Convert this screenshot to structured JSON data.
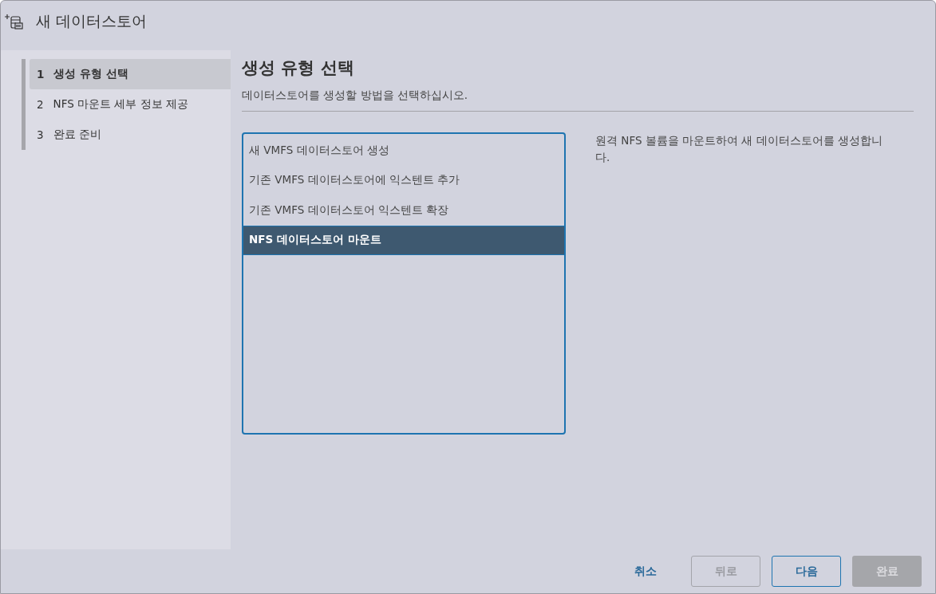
{
  "window": {
    "title": "새 데이터스토어"
  },
  "steps": [
    {
      "number": "1",
      "label": "생성 유형 선택",
      "selected": true
    },
    {
      "number": "2",
      "label": "NFS 마운트 세부 정보 제공",
      "selected": false
    },
    {
      "number": "3",
      "label": "완료 준비",
      "selected": false
    }
  ],
  "page": {
    "title": "생성 유형 선택",
    "subtitle": "데이터스토어를 생성할 방법을 선택하십시오."
  },
  "options": [
    {
      "label": "새 VMFS 데이터스토어 생성",
      "selected": false
    },
    {
      "label": "기존 VMFS 데이터스토어에 익스텐트 추가",
      "selected": false
    },
    {
      "label": "기존 VMFS 데이터스토어 익스텐트 확장",
      "selected": false
    },
    {
      "label": "NFS 데이터스토어 마운트",
      "selected": true
    }
  ],
  "description": "원격 NFS 볼륨을 마운트하여 새 데이터스토어를 생성합니다.",
  "buttons": [
    {
      "label": "취소",
      "kind": "link",
      "disabled": false
    },
    {
      "label": "뒤로",
      "kind": "outline",
      "disabled": true
    },
    {
      "label": "다음",
      "kind": "outline",
      "disabled": false
    },
    {
      "label": "완료",
      "kind": "primary",
      "disabled": true
    }
  ]
}
